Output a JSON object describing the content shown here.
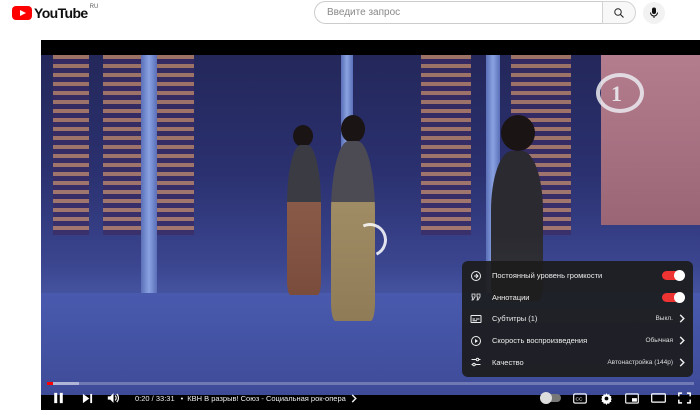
{
  "masthead": {
    "logo_text": "YouTube",
    "logo_region": "RU",
    "search_placeholder": "Введите запрос"
  },
  "player": {
    "settings_menu": {
      "items": [
        {
          "label": "Постоянный уровень громкости",
          "type": "toggle",
          "on": true,
          "icon": "stable-volume-icon"
        },
        {
          "label": "Аннотации",
          "type": "toggle",
          "on": true,
          "icon": "annotations-icon"
        },
        {
          "label": "Субтитры (1)",
          "value": "Выкл.",
          "icon": "subtitles-icon"
        },
        {
          "label": "Скорость воспроизведения",
          "value": "Обычная",
          "icon": "playback-speed-icon"
        },
        {
          "label": "Качество",
          "value": "Автонастройка (144p)",
          "icon": "quality-icon"
        }
      ]
    },
    "controls": {
      "current_time": "0:20",
      "duration": "33:31",
      "time_text": "0:20 / 33:31",
      "chapter_separator": "•",
      "chapter_title": "КВН В разрыв! Союз - Социальная рок-опера",
      "progress_played_fraction": 0.0099,
      "progress_loaded_fraction": 0.05
    }
  },
  "colors": {
    "brand_red": "#ff0000",
    "toggle_on": "#ee3333",
    "menu_bg": "#1c1c1c"
  }
}
